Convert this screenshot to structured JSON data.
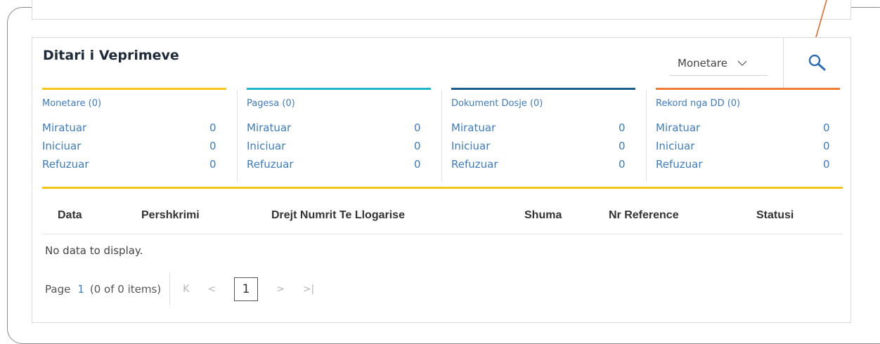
{
  "panel": {
    "title": "Ditari i Veprimeve",
    "filter_value": "Monetare"
  },
  "colors": {
    "monetare": "#f5c518",
    "pagesa": "#1fb6c9",
    "dokument": "#1b5e8c",
    "rekord": "#ee7d33",
    "link": "#3d7bbf",
    "arrow": "#e46b2c"
  },
  "summary": [
    {
      "header": "Monetare (0)",
      "rows": [
        {
          "label": "Miratuar",
          "value": "0"
        },
        {
          "label": "Iniciuar",
          "value": "0"
        },
        {
          "label": "Refuzuar",
          "value": "0"
        }
      ]
    },
    {
      "header": "Pagesa (0)",
      "rows": [
        {
          "label": "Miratuar",
          "value": "0"
        },
        {
          "label": "Iniciuar",
          "value": "0"
        },
        {
          "label": "Refuzuar",
          "value": "0"
        }
      ]
    },
    {
      "header": "Dokument Dosje (0)",
      "rows": [
        {
          "label": "Miratuar",
          "value": "0"
        },
        {
          "label": "Iniciuar",
          "value": "0"
        },
        {
          "label": "Refuzuar",
          "value": "0"
        }
      ]
    },
    {
      "header": "Rekord nga DD (0)",
      "rows": [
        {
          "label": "Miratuar",
          "value": "0"
        },
        {
          "label": "Iniciuar",
          "value": "0"
        },
        {
          "label": "Refuzuar",
          "value": "0"
        }
      ]
    }
  ],
  "table": {
    "columns": [
      "Data",
      "Pershkrimi",
      "Drejt Numrit Te Llogarise",
      "Shuma",
      "Nr Reference",
      "Statusi"
    ],
    "empty_text": "No data to display."
  },
  "pager": {
    "page_label": "Page",
    "page_number": "1",
    "items_text": "(0 of 0 items)",
    "current_page": "1",
    "icons": [
      "first-page-icon",
      "prev-page-icon",
      "next-page-icon",
      "last-page-icon"
    ]
  }
}
